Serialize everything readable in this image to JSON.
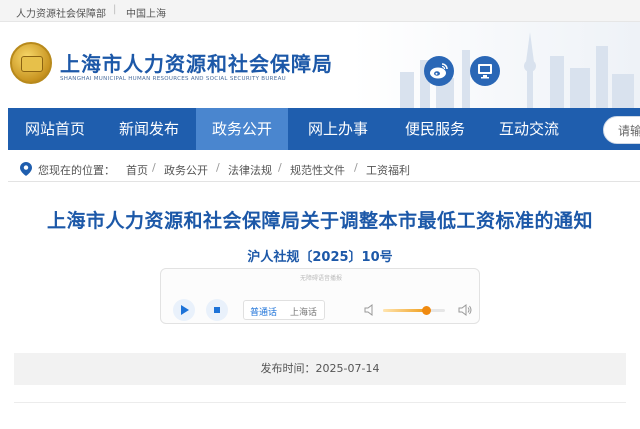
{
  "topbar": {
    "link1": "人力资源社会保障部",
    "separator": "|",
    "link2": "中国上海"
  },
  "header": {
    "title": "上海市人力资源和社会保障局",
    "subtitle": "SHANGHAI MUNICIPAL HUMAN RESOURCES AND SOCIAL SECURITY BUREAU",
    "icons": [
      "logo-icon",
      "weibo-icon",
      "desktop-icon"
    ]
  },
  "nav": {
    "items": [
      {
        "label": "网站首页"
      },
      {
        "label": "新闻发布"
      },
      {
        "label": "政务公开"
      },
      {
        "label": "网上办事"
      },
      {
        "label": "便民服务"
      },
      {
        "label": "互动交流"
      }
    ],
    "active_index": 2,
    "search_placeholder": "请输"
  },
  "breadcrumb": {
    "label": "您现在的位置：",
    "items": [
      "首页",
      "政务公开",
      "法律法规",
      "规范性文件",
      "工资福利"
    ],
    "separator": "/"
  },
  "article": {
    "title": "上海市人力资源和社会保障局关于调整本市最低工资标准的通知",
    "doc_number": "沪人社规〔2025〕10号",
    "publish_time": "发布时间：2025-07-14"
  },
  "player": {
    "hint": "无障碍语音播报",
    "lang_primary": "普通话",
    "lang_secondary": "上海话",
    "volume": 0.7
  },
  "colors": {
    "brand": "#1c58a8",
    "nav_bg": "#1f5eae",
    "nav_active": "#4a86cf",
    "accent": "#f08a10"
  }
}
